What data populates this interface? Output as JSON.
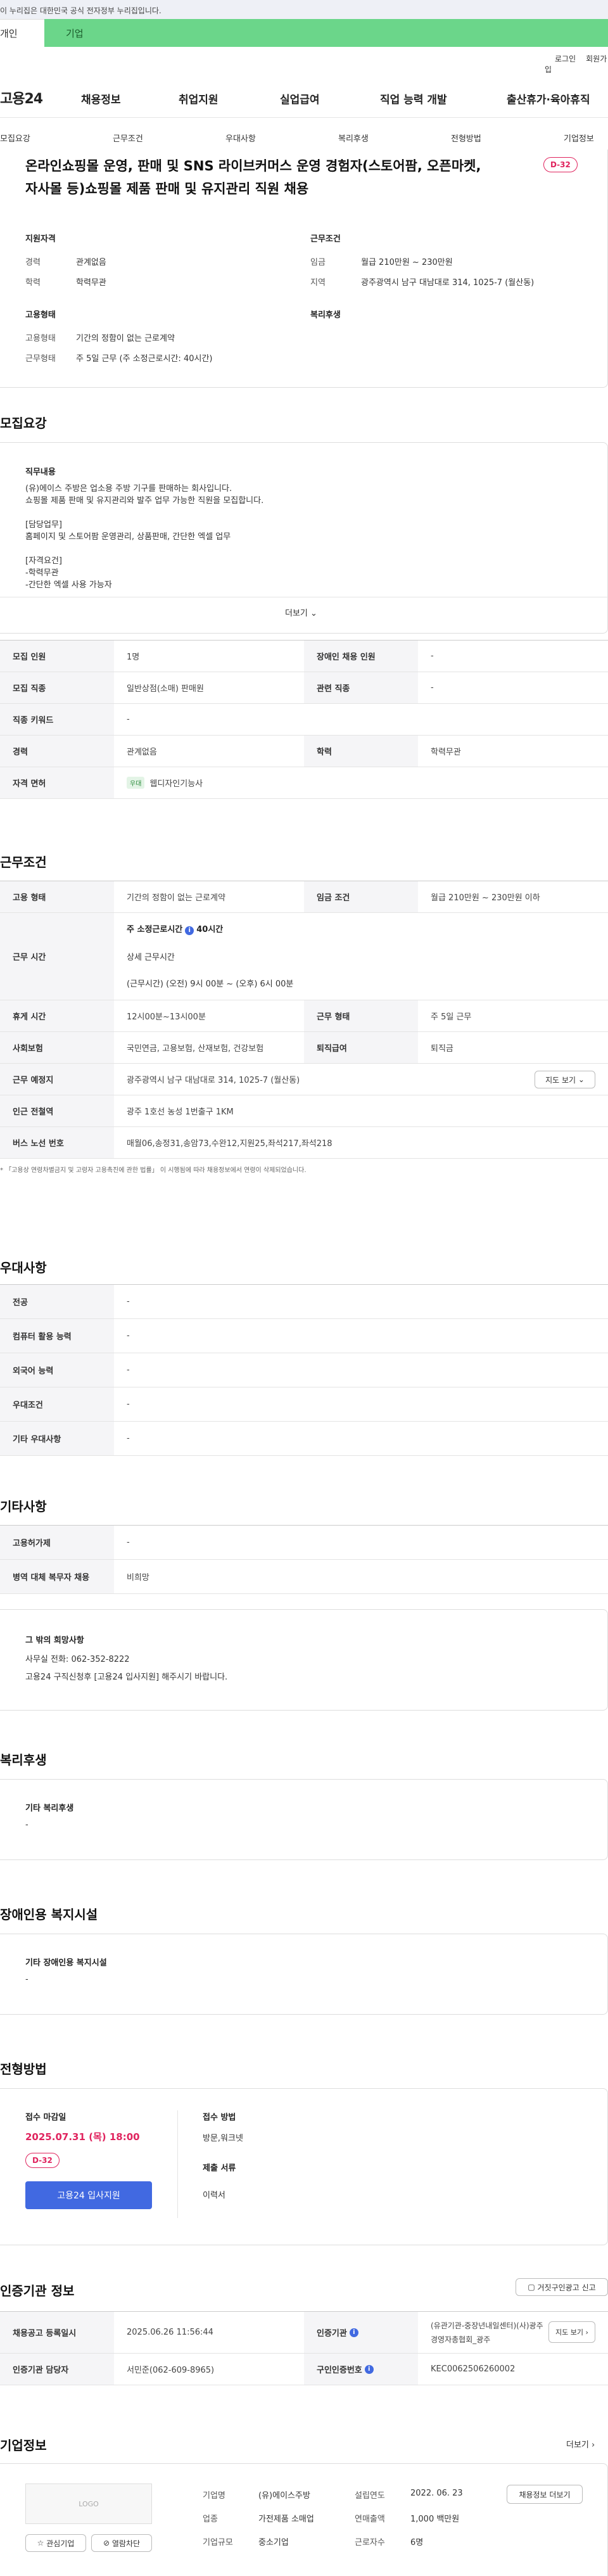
{
  "topbar": {
    "notice": "이 누리집은 대한민국 공식 전자정부 누리집입니다."
  },
  "user_tabs": {
    "individual": "개인",
    "business": "기업"
  },
  "util": {
    "login": "로그인",
    "join": "회원가입"
  },
  "gnb": {
    "logo": "고용24",
    "items": [
      "채용정보",
      "취업지원",
      "실업급여",
      "직업 능력 개발",
      "출산휴가·육아휴직"
    ]
  },
  "snb": {
    "items": [
      "모집요강",
      "근무조건",
      "우대사항",
      "복리후생",
      "전형방법",
      "기업정보"
    ]
  },
  "job": {
    "title": "온라인쇼핑몰 운영, 판매 및 SNS 라이브커머스 운영 경험자(스토어팜, 오픈마켓, 자사몰 등)쇼핑몰 제품 판매 및 유지관리 직원 채용",
    "dday": "D-32",
    "qual": {
      "title": "지원자격",
      "career_label": "경력",
      "career": "관계없음",
      "edu_label": "학력",
      "edu": "학력무관"
    },
    "cond": {
      "title": "근무조건",
      "wage_label": "임금",
      "wage": "월급 210만원 ~ 230만원",
      "region_label": "지역",
      "region": "광주광역시 남구 대남대로 314, 1025-7 (월산동)"
    },
    "type": {
      "title": "고용형태",
      "emp_label": "고용형태",
      "emp": "기간의 정함이 없는 근로계약",
      "hours_label": "근무형태",
      "hours": "주 5일 근무 (주 소정근로시간: 40시간)"
    },
    "welfare": {
      "title": "복리후생"
    }
  },
  "recruit": {
    "heading": "모집요강",
    "duty_title": "직무내용",
    "duty_lines": [
      "(유)에이스 주방은 업소용 주방 기구를 판매하는 회사입니다.",
      "쇼핑몰 제품 판매 및 유지관리와 발주 업무 가능한 직원을 모집합니다.",
      "",
      "[담당업무]",
      " 홈페이지 및 스토어팜 운영관리, 상품판매, 간단한 엑셀 업무",
      "",
      "[자격요건]",
      "-학력무관",
      "-간단한 엑셀 사용 가능자"
    ],
    "more": "더보기",
    "table": {
      "headcount_label": "모집 인원",
      "headcount": "1명",
      "disabled_label": "장애인 채용 인원",
      "disabled": "-",
      "job_label": "모집 직종",
      "job": "일반상점(소매) 판매원",
      "related_label": "관련 직종",
      "related": "-",
      "keyword_label": "직종 키워드",
      "keyword": "-",
      "career_label": "경력",
      "career": "관계없음",
      "edu_label": "학력",
      "edu": "학력무관",
      "license_label": "자격 면허",
      "license_tag": "우대",
      "license": "웹디자인기능사"
    }
  },
  "workcond": {
    "heading": "근무조건",
    "emp_label": "고용 형태",
    "emp": "기간의 정함이 없는 근로계약",
    "wage_label": "임금 조건",
    "wage": "월급 210만원 ~ 230만원 이하",
    "time_label": "근무 시간",
    "weekly_label": "주 소정근로시간",
    "weekly": "40시간",
    "detail_label": "상세 근무시간",
    "detail": "(근무시간) (오전) 9시 00분 ~ (오후) 6시 00분",
    "break_label": "휴게 시간",
    "break": "12시00분~13시00분",
    "form_label": "근무 형태",
    "form": "주 5일 근무",
    "ins_label": "사회보험",
    "ins": "국민연금, 고용보험, 산재보험, 건강보험",
    "sev_label": "퇴직급여",
    "sev": "퇴직금",
    "place_label": "근무 예정지",
    "place": "광주광역시 남구 대남대로 314, 1025-7 (월산동)",
    "map_btn": "지도 보기",
    "subway_label": "인근 전철역",
    "subway": "광주 1호선 농성 1번출구 1KM",
    "bus_label": "버스 노선 번호",
    "bus": "매월06,송정31,송암73,수완12,지원25,좌석217,좌석218",
    "note": "「고용상 연령차별금지 및 고령자 고용촉진에 관한 법률」 이 시행됨에 따라 채용정보에서 연령이 삭제되었습니다."
  },
  "pref": {
    "heading": "우대사항",
    "rows": [
      {
        "label": "전공",
        "value": "-"
      },
      {
        "label": "컴퓨터 활용 능력",
        "value": "-"
      },
      {
        "label": "외국어 능력",
        "value": "-"
      },
      {
        "label": "우대조건",
        "value": "-"
      },
      {
        "label": "기타 우대사항",
        "value": "-"
      }
    ]
  },
  "etc": {
    "heading": "기타사항",
    "rows": [
      {
        "label": "고용허가제",
        "value": "-"
      },
      {
        "label": "병역 대체 복무자 채용",
        "value": "비희망"
      }
    ],
    "box_title": "그 밖의 희망사항",
    "box_lines": [
      "사무실 전화: 062-352-8222",
      "고용24 구직신청후 [고용24 입사지원] 해주시기 바랍니다."
    ]
  },
  "welfare": {
    "heading": "복리후생",
    "sub": "기타 복리후생",
    "value": "-"
  },
  "facility": {
    "heading": "장애인용 복지시설",
    "sub": "기타 장애인용 복지시설",
    "value": "-"
  },
  "process": {
    "heading": "전형방법",
    "deadline_label": "접수 마감일",
    "deadline": "2025.07.31 (목) 18:00",
    "dday": "D-32",
    "apply_btn": "고용24 입사지원",
    "method_label": "접수 방법",
    "method": "방문,워크넷",
    "docs_label": "제출 서류",
    "docs": "이력서"
  },
  "cert": {
    "heading": "인증기관 정보",
    "report_btn": "거짓구인광고 신고",
    "reg_label": "채용공고 등록일시",
    "reg": "2025.06.26 11:56:44",
    "org_label": "인증기관",
    "org": "(유관기관-중장년내일센터)(사)광주경영자총협회_광주",
    "map_btn": "지도 보기",
    "mgr_label": "인증기관 담당자",
    "mgr": "서민준(062-609-8965)",
    "id_label": "구인인증번호",
    "id": "KEC0062506260002"
  },
  "company": {
    "heading": "기업정보",
    "more": "더보기",
    "logo": "LOGO",
    "name_label": "기업명",
    "name": "(유)에이스주방",
    "year_label": "설립연도",
    "year": "2022. 06. 23",
    "industry_label": "업종",
    "industry": "가전제품 소매업",
    "sales_label": "연매출액",
    "sales": "1,000 백만원",
    "size_label": "기업규모",
    "size": "중소기업",
    "emp_label": "근로자수",
    "emp": "6명",
    "jobs_btn": "채용정보 더보기",
    "fav_btn": "관심기업",
    "block_btn": "열람차단"
  }
}
